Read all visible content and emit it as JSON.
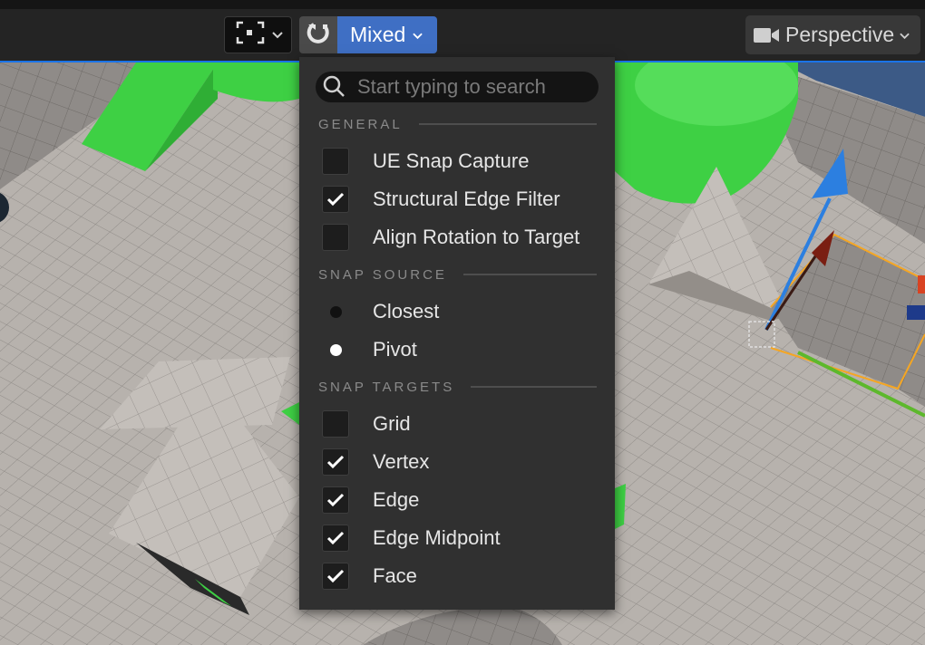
{
  "toolbar": {
    "snap_mode_label": "Mixed",
    "viewport_mode_label": "Perspective",
    "accent_color": "#3f6fc4"
  },
  "menu": {
    "search_placeholder": "Start typing to search",
    "sections": {
      "general": "GENERAL",
      "snap_source": "SNAP SOURCE",
      "snap_targets": "SNAP TARGETS"
    },
    "general_items": [
      {
        "label": "UE Snap Capture",
        "checked": false
      },
      {
        "label": "Structural Edge Filter",
        "checked": true
      },
      {
        "label": "Align Rotation to Target",
        "checked": false
      }
    ],
    "source_items": [
      {
        "label": "Closest",
        "selected": false
      },
      {
        "label": "Pivot",
        "selected": true
      }
    ],
    "target_items": [
      {
        "label": "Grid",
        "checked": false
      },
      {
        "label": "Vertex",
        "checked": true
      },
      {
        "label": "Edge",
        "checked": true
      },
      {
        "label": "Edge Midpoint",
        "checked": true
      },
      {
        "label": "Face",
        "checked": true
      }
    ]
  },
  "icons": {
    "frame": "frame-selection-icon",
    "snap": "snap-magnet-icon",
    "camera": "camera-icon",
    "search": "search-icon",
    "check": "check-icon"
  }
}
